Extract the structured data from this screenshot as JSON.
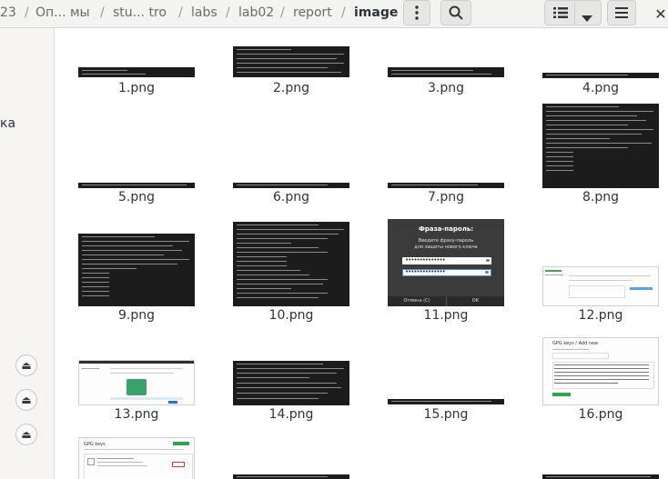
{
  "breadcrumb": [
    "23",
    "Оп... мы",
    "stu... tro",
    "labs",
    "lab02",
    "report",
    "image"
  ],
  "sidebar": {
    "partial_label": "ка"
  },
  "header": {
    "menu_icon": "kebab-icon",
    "search_icon": "search-icon",
    "list_icon": "list-view-icon",
    "dropdown_icon": "chevron-down-icon",
    "hamburger_icon": "hamburger-icon",
    "close_icon": "close-icon"
  },
  "files": [
    {
      "name": "1.png"
    },
    {
      "name": "2.png"
    },
    {
      "name": "3.png"
    },
    {
      "name": "4.png"
    },
    {
      "name": "5.png"
    },
    {
      "name": "6.png"
    },
    {
      "name": "7.png"
    },
    {
      "name": "8.png"
    },
    {
      "name": "9.png"
    },
    {
      "name": "10.png"
    },
    {
      "name": "11.png"
    },
    {
      "name": "12.png"
    },
    {
      "name": "13.png"
    },
    {
      "name": "14.png"
    },
    {
      "name": "15.png"
    },
    {
      "name": "16.png"
    }
  ],
  "dialog": {
    "title": "Фраза-пароль:",
    "subtitle1": "Введите фразу-пароль",
    "subtitle2": "для защиты нового ключа",
    "cancel": "Отмена (С)",
    "ok": "ОК"
  },
  "gpg_card": {
    "title": "GPG keys / Add new",
    "heading": "GPG keys"
  }
}
